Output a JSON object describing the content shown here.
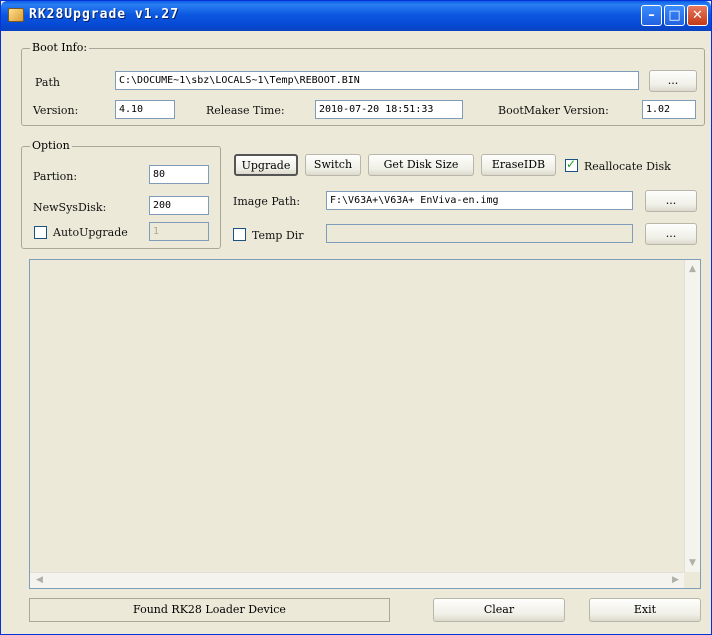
{
  "window": {
    "title": "RK28Upgrade v1.27",
    "minimize_glyph": "–",
    "maximize_glyph": "□",
    "close_glyph": "✕"
  },
  "boot_info": {
    "group_label": "Boot Info:",
    "path_label": "Path",
    "path_value": "C:\\DOCUME~1\\sbz\\LOCALS~1\\Temp\\REBOOT.BIN",
    "browse_label": "...",
    "version_label": "Version:",
    "version_value": "4.10",
    "release_time_label": "Release Time:",
    "release_time_value": "2010-07-20 18:51:33",
    "bootmaker_label": "BootMaker Version:",
    "bootmaker_value": "1.02"
  },
  "option": {
    "group_label": "Option",
    "partion_label": "Partion:",
    "partion_value": "80",
    "newsysdisk_label": "NewSysDisk:",
    "newsysdisk_value": "200",
    "autoupgrade_label": "AutoUpgrade",
    "autoupgrade_checked": false,
    "autoupgrade_value": "1"
  },
  "actions": {
    "upgrade": "Upgrade",
    "switch": "Switch",
    "get_disk_size": "Get Disk Size",
    "erase_idb": "EraseIDB",
    "reallocate_label": "Reallocate Disk",
    "reallocate_checked": true
  },
  "image": {
    "label": "Image Path:",
    "value": "F:\\V63A+\\V63A+ EnViva-en.img",
    "browse_label": "..."
  },
  "temp_dir": {
    "label": "Temp Dir",
    "checked": false,
    "value": "",
    "browse_label": "..."
  },
  "log": {
    "scroll_up": "▲",
    "scroll_down": "▼",
    "scroll_left": "◀",
    "scroll_right": "▶"
  },
  "footer": {
    "status": "Found RK28 Loader Device",
    "clear": "Clear",
    "exit": "Exit"
  }
}
